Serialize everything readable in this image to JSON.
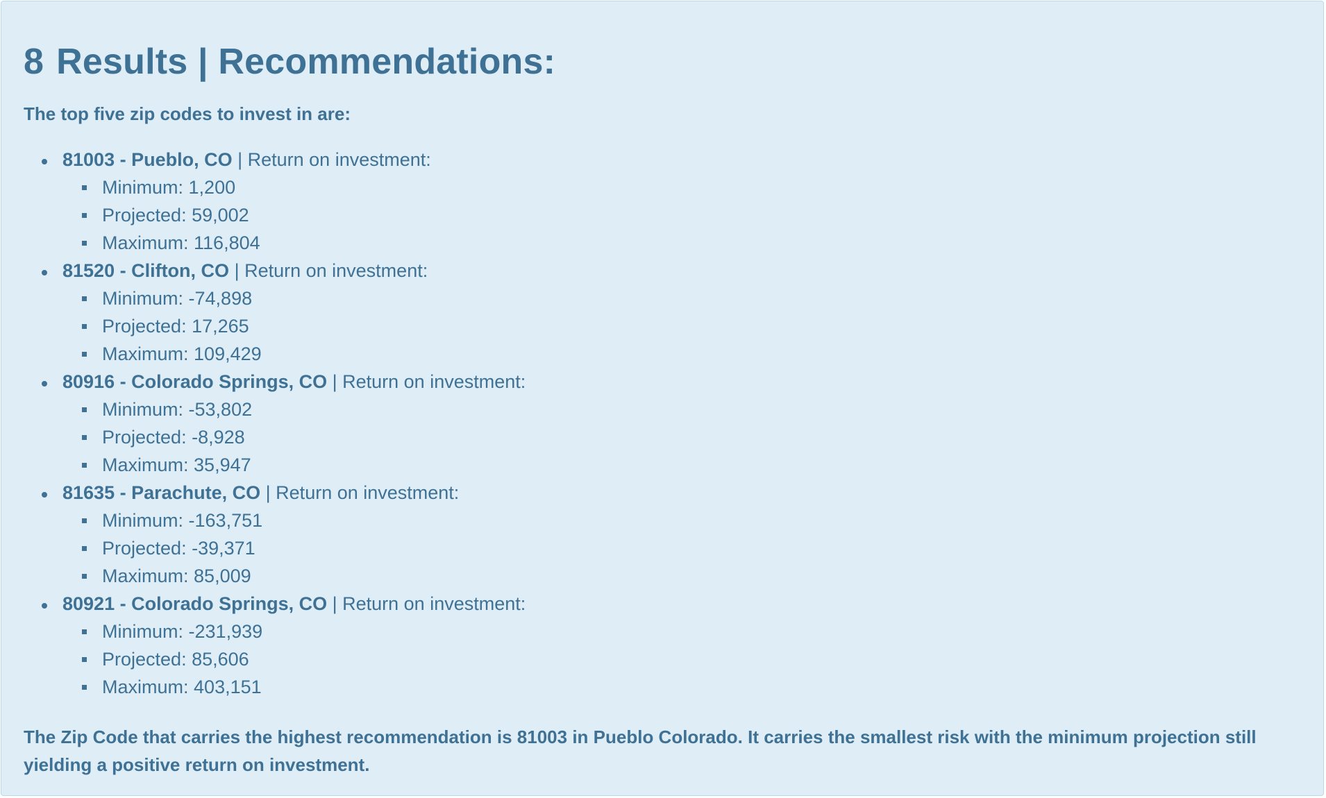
{
  "section": {
    "number": "8",
    "title": "Results | Recommendations:"
  },
  "intro": "The top five zip codes to invest in are:",
  "roi_label": "| Return on investment:",
  "metric_labels": {
    "min": "Minimum:",
    "projected": "Projected:",
    "max": "Maximum:"
  },
  "zips": [
    {
      "name": "81003 - Pueblo, CO",
      "min": "1,200",
      "projected": "59,002",
      "max": "116,804"
    },
    {
      "name": "81520 - Clifton, CO",
      "min": "-74,898",
      "projected": "17,265",
      "max": "109,429"
    },
    {
      "name": "80916 - Colorado Springs, CO",
      "min": "-53,802",
      "projected": "-8,928",
      "max": "35,947"
    },
    {
      "name": "81635 - Parachute, CO",
      "min": "-163,751",
      "projected": "-39,371",
      "max": "85,009"
    },
    {
      "name": "80921 - Colorado Springs, CO",
      "min": "-231,939",
      "projected": "85,606",
      "max": "403,151"
    }
  ],
  "conclusion": "The Zip Code that carries the highest recommendation is 81003 in Pueblo Colorado. It carries the smallest risk with the minimum projection still yielding a positive return on investment.",
  "colors": {
    "panel_background": "#deedf6",
    "panel_border": "#b9dbe8",
    "text": "#3f7195"
  }
}
